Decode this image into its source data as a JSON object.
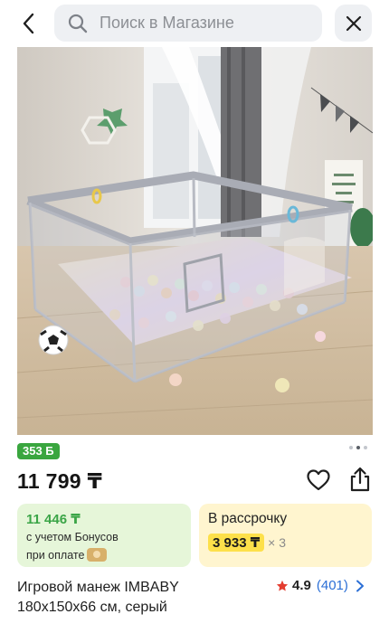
{
  "search": {
    "placeholder": "Поиск в Магазине"
  },
  "product": {
    "bonus_badge": "353 Б",
    "price": "11 799 ₸",
    "title_line1": "Игровой манеж IMBABY",
    "title_line2": "180x150x66 см, серый",
    "rating": "4.9",
    "reviews": "(401)"
  },
  "bonus_card": {
    "amount": "11 446 ₸",
    "line1": "с учетом Бонусов",
    "line2": "при оплате"
  },
  "installment_card": {
    "title": "В рассрочку",
    "amount": "3 933 ₸",
    "times": "× 3"
  },
  "gallery": {
    "image_count": 3,
    "active_index": 1
  },
  "colors": {
    "bonus_green": "#3aa63f",
    "installment_yellow": "#fde04a",
    "link_blue": "#2b6fd6",
    "star_red": "#e43d30"
  }
}
